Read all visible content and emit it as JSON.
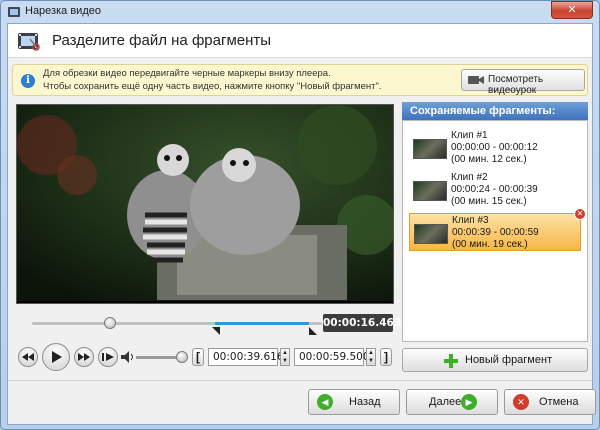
{
  "window": {
    "title": "Нарезка видео",
    "close_label": "✕"
  },
  "header": {
    "title": "Разделите файл на фрагменты"
  },
  "hint": {
    "line1": "Для обрезки видео передвигайте черные маркеры внизу плеера.",
    "line2": "Чтобы сохранить ещё одну часть видео, нажмите кнопку \"Новый фрагмент\".",
    "tutorial_label": "Посмотреть видеоурок"
  },
  "player": {
    "current_time": "00:00:16.463",
    "playhead_fraction": 0.28,
    "selection_start_fraction": 0.66,
    "selection_end_fraction": 1.0,
    "volume_fraction": 0.9,
    "start_time": "00:00:39.616",
    "end_time": "00:00:59.500",
    "start_bracket": "[",
    "end_bracket": "]"
  },
  "panel": {
    "title": "Сохраняемые фрагменты:",
    "clips": [
      {
        "name": "Клип #1",
        "range": "00:00:00 - 00:00:12",
        "duration": "(00 мин. 12 сек.)"
      },
      {
        "name": "Клип #2",
        "range": "00:00:24 - 00:00:39",
        "duration": "(00 мин. 15 сек.)"
      },
      {
        "name": "Клип #3",
        "range": "00:00:39 - 00:00:59",
        "duration": "(00 мин. 19 сек.)"
      }
    ],
    "selected_index": 2,
    "new_fragment_label": "Новый фрагмент"
  },
  "footer": {
    "back_label": "Назад",
    "next_label": "Далее",
    "cancel_label": "Отмена"
  },
  "colors": {
    "accent": "#3e73bc",
    "selected": "#f7b645",
    "timeline_selection": "#2a9ad8"
  }
}
